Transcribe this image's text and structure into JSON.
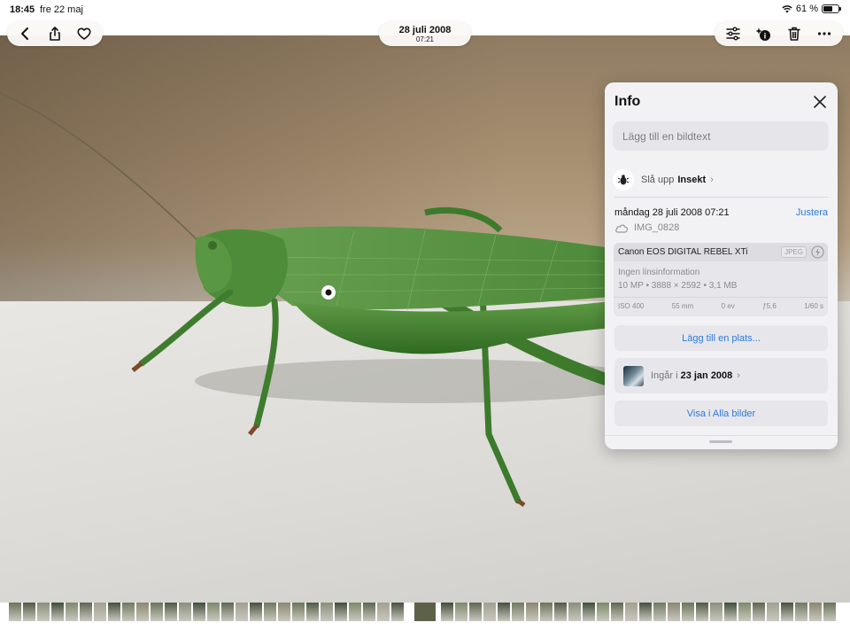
{
  "status_bar": {
    "time": "18:45",
    "date": "fre 22 maj",
    "battery_text": "61 %",
    "battery_level": 0.61
  },
  "header": {
    "date_title": "28 juli 2008",
    "time_subtitle": "07:21",
    "left_icons": [
      "back-chevron-icon",
      "share-icon",
      "heart-icon"
    ],
    "right_icons": [
      "adjust-sliders-icon",
      "info-lookup-icon",
      "trash-icon",
      "more-ellipsis-icon"
    ]
  },
  "info_panel": {
    "title": "Info",
    "caption_placeholder": "Lägg till en bildtext",
    "lookup_prefix": "Slå upp",
    "lookup_subject": "Insekt",
    "datetime": "måndag 28 juli 2008 07:21",
    "adjust_label": "Justera",
    "filename": "IMG_0828",
    "camera": {
      "model": "Canon EOS DIGITAL REBEL XTi",
      "format": "JPEG",
      "lens": "Ingen linsinformation",
      "specs": "10 MP • 3888 × 2592 • 3,1 MB",
      "exif": [
        "ISO 400",
        "55 mm",
        "0 ev",
        "ƒ5,6",
        "1/60 s"
      ]
    },
    "add_location_label": "Lägg till en plats...",
    "album_prefix": "Ingår i",
    "album_date": "23 jan 2008",
    "show_all_label": "Visa i Alla bilder"
  },
  "colors": {
    "accent": "#2f7ad9",
    "panel_bg": "#f2f2f5",
    "grasshopper_green": "#4a8a34"
  }
}
